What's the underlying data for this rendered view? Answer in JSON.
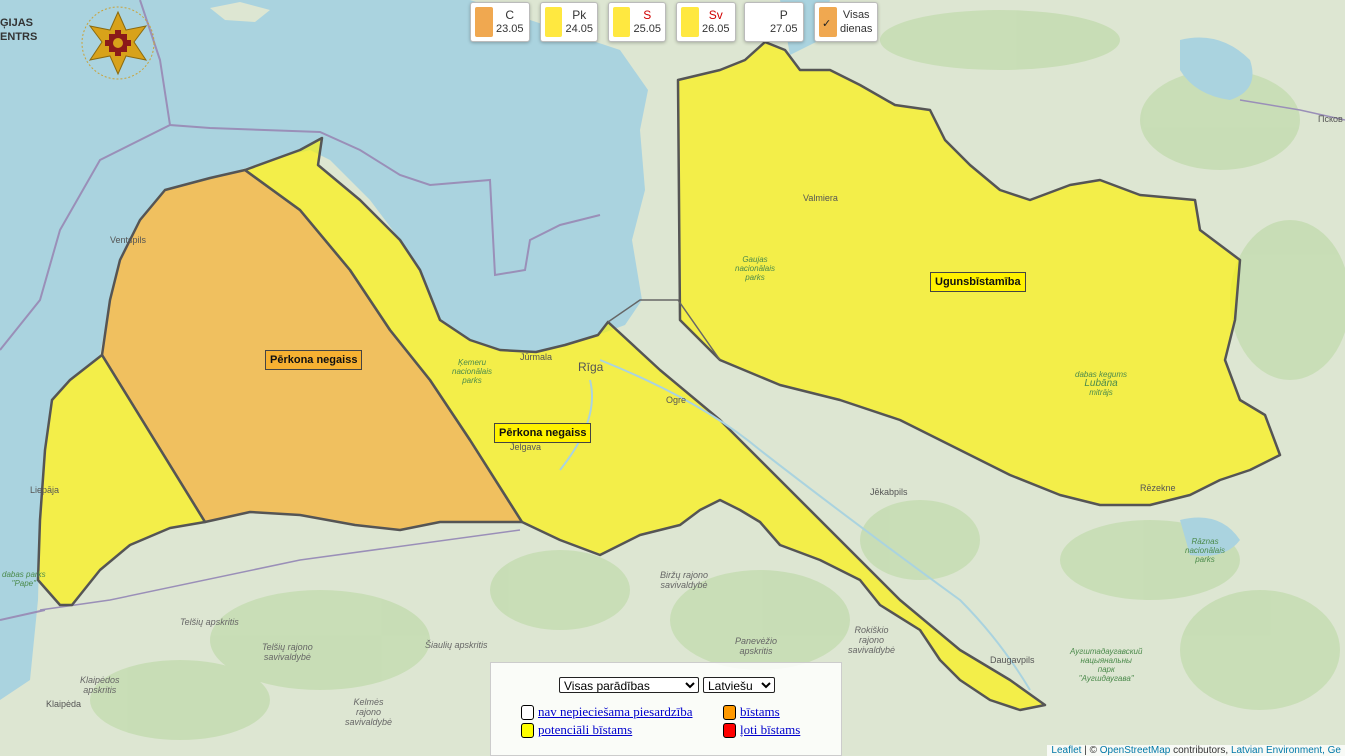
{
  "logo": {
    "text_left_line1": "ĢIJAS",
    "text_left_line2": "ENTRS"
  },
  "days": [
    {
      "name": "C",
      "date": "23.05",
      "color": "#f0a850",
      "name_color": "#333"
    },
    {
      "name": "Pk",
      "date": "24.05",
      "color": "#ffe840",
      "name_color": "#333"
    },
    {
      "name": "S",
      "date": "25.05",
      "color": "#ffe840",
      "name_color": "#d00000"
    },
    {
      "name": "Sv",
      "date": "26.05",
      "color": "#ffe840",
      "name_color": "#d00000"
    },
    {
      "name": "P",
      "date": "27.05",
      "color": "#ffffff",
      "name_color": "#333"
    }
  ],
  "all_days": {
    "line1": "Visas",
    "line2": "dienas",
    "color": "#f0a850"
  },
  "warnings": [
    {
      "label": "Pērkona negaiss",
      "color": "#f6b132"
    },
    {
      "label": "Pērkona negaiss",
      "color": "#fff200"
    },
    {
      "label": "Ugunsbīstamība",
      "color": "#fff200"
    }
  ],
  "cities": [
    "Ventspils",
    "Jūrmala",
    "Rīga",
    "Ogre",
    "Jelgava",
    "Valmiera",
    "Jēkabpils",
    "Rēzekne",
    "Liepāja",
    "Daugavpils",
    "Klaipėda",
    "Псков"
  ],
  "regions": [
    {
      "l1": "Telšių apskritis"
    },
    {
      "l1": "Šiaulių apskritis"
    },
    {
      "l1": "Panevėžio",
      "l2": "apskritis"
    },
    {
      "l1": "Biržų rajono",
      "l2": "savivaldybė"
    },
    {
      "l1": "Rokiškio",
      "l2": "rajono",
      "l3": "savivaldybė"
    },
    {
      "l1": "Telšių rajono",
      "l2": "savivaldybė"
    },
    {
      "l1": "Kelmės",
      "l2": "rajono",
      "l3": "savivaldybė"
    },
    {
      "l1": "Klaipėdos",
      "l2": "apskritis"
    }
  ],
  "parks": [
    {
      "l1": "Ķemeru",
      "l2": "nacionālais",
      "l3": "parks"
    },
    {
      "l1": "Gaujas",
      "l2": "nacionālais",
      "l3": "parks"
    },
    {
      "l1": "dabas kegums",
      "l2": "Lubāna",
      "l3": "mitrājs"
    },
    {
      "l1": "Rāznas",
      "l2": "nacionālais",
      "l3": "parks"
    },
    {
      "l1": "dabas parks",
      "l2": "\"Pape\""
    },
    {
      "l1": "Аугштадаугавский",
      "l2": "нацыянальны",
      "l3": "парк",
      "l4": "\"Аугшдаугава\""
    }
  ],
  "legend": {
    "select_main": {
      "value": "Visas parādības"
    },
    "select_lang": {
      "value": "Latviešu"
    },
    "items": [
      {
        "label": "nav nepieciešama piesardzība",
        "color": "#ffffff"
      },
      {
        "label": "bīstams",
        "color": "#ff9900"
      },
      {
        "label": "potenciāli bīstams",
        "color": "#ffff00"
      },
      {
        "label": "ļoti bīstams",
        "color": "#ff0000"
      }
    ]
  },
  "attribution": {
    "leaflet": "Leaflet",
    "sep": " | © ",
    "osm": "OpenStreetMap",
    "rest": " contributors, ",
    "le": "Latvian Environment, Ge"
  }
}
